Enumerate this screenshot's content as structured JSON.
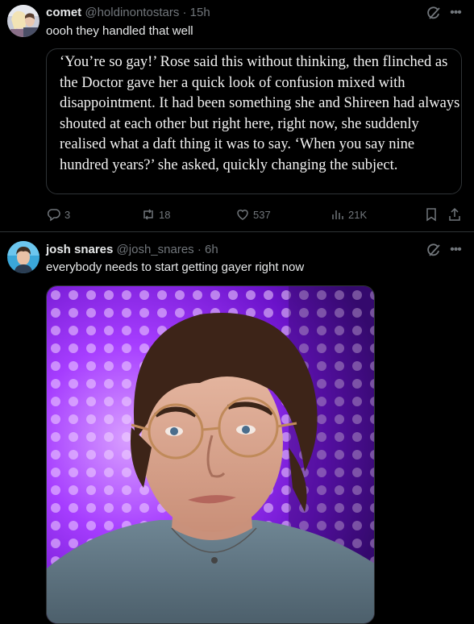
{
  "tweets": [
    {
      "display_name": "comet",
      "handle": "@holdinontostars",
      "time": "15h",
      "text": "oooh they handled that well",
      "quote_text": "‘You’re so gay!’ Rose said this without thinking, then flinched as the Doctor gave her a quick look of confusion mixed with disappointment. It had been something she and Shireen had always shouted at each other but right here, right now, she suddenly realised what a daft thing it was to say. ‘When you say nine hundred years?’ she asked, quickly changing the subject.",
      "actions": {
        "replies": "3",
        "reposts": "18",
        "likes": "537",
        "views": "21K"
      }
    },
    {
      "display_name": "josh snares",
      "handle": "@josh_snares",
      "time": "6h",
      "text": "everybody needs to start getting gayer right now"
    }
  ],
  "icons": {
    "grok": "grok-icon",
    "more": "more-icon",
    "reply": "reply-icon",
    "repost": "repost-icon",
    "like": "heart-icon",
    "views": "views-icon",
    "bookmark": "bookmark-icon",
    "share": "share-icon"
  },
  "colors": {
    "background": "#000000",
    "text": "#e7e9ea",
    "secondary": "#71767b",
    "border": "#2f3336"
  }
}
